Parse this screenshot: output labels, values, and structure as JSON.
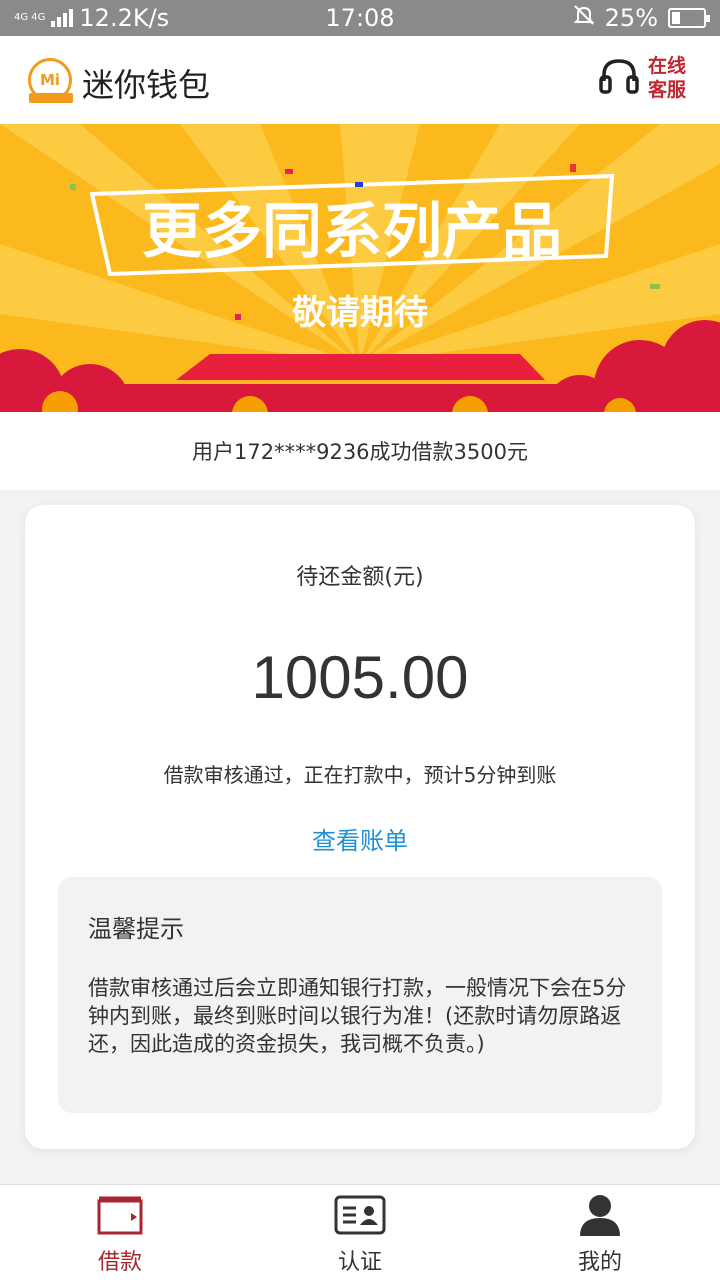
{
  "status_bar": {
    "network_type": "4G 4G",
    "speed": "12.2K/s",
    "time": "17:08",
    "battery": "25%",
    "battery_level": 0.25
  },
  "header": {
    "app_title": "迷你钱包",
    "service_label": "在线客服"
  },
  "banner": {
    "headline": "更多同系列产品",
    "subline": "敬请期待"
  },
  "ticker": {
    "text": "用户172****9236成功借款3500元"
  },
  "loan": {
    "amount_label": "待还金额(元)",
    "amount": "1005.00",
    "status": "借款审核通过，正在打款中，预计5分钟到账",
    "view_bill": "查看账单"
  },
  "tips": {
    "title": "温馨提示",
    "body": "借款审核通过后会立即通知银行打款，一般情况下会在5分钟内到账，最终到账时间以银行为准！(还款时请勿原路返还，因此造成的资金损失，我司概不负责。)"
  },
  "nav": {
    "items": [
      {
        "label": "借款",
        "icon": "wallet-icon",
        "active": true
      },
      {
        "label": "认证",
        "icon": "id-card-icon",
        "active": false
      },
      {
        "label": "我的",
        "icon": "user-icon",
        "active": false
      }
    ]
  },
  "colors": {
    "accent_red": "#a8262f",
    "link_blue": "#1e90d6",
    "banner_yellow": "#fbb91d",
    "banner_red": "#d8193b"
  }
}
